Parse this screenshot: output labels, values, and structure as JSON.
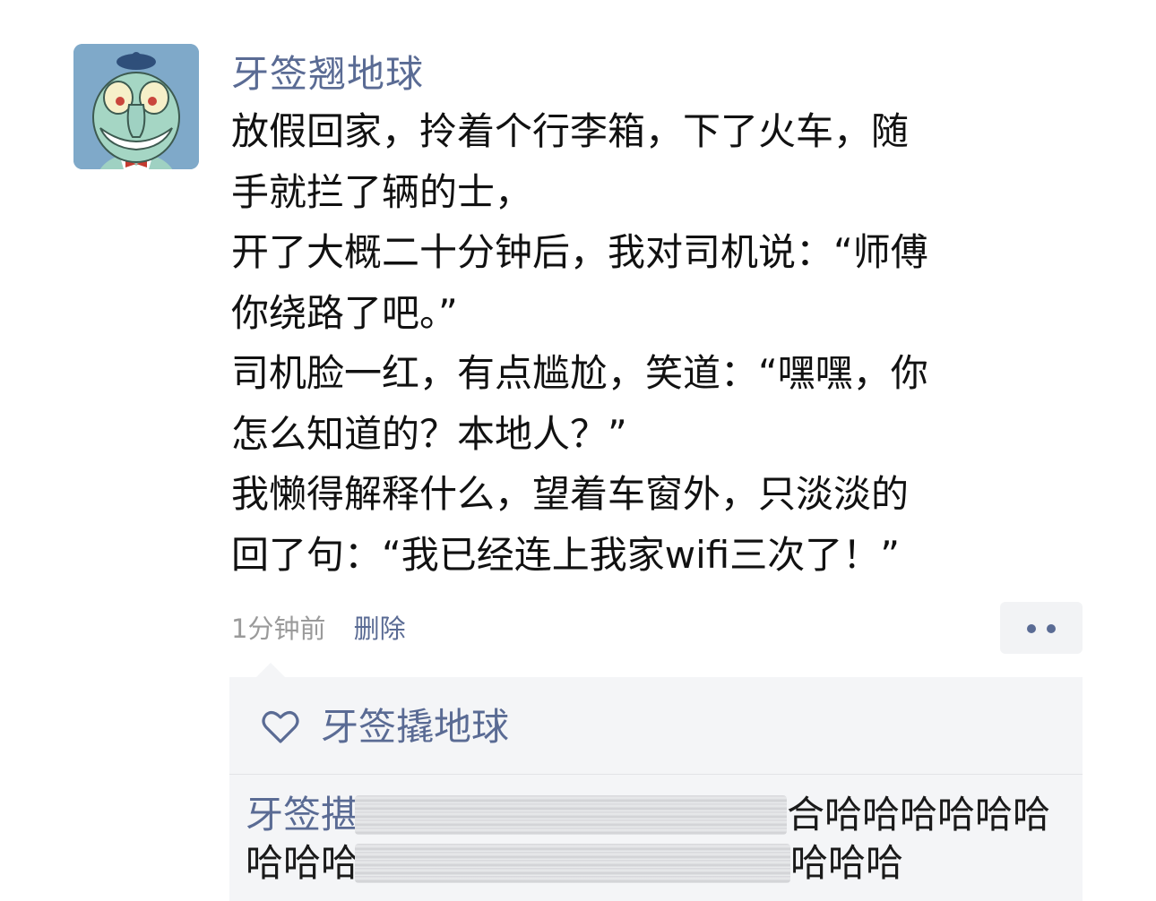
{
  "post": {
    "username": "牙签翘地球",
    "lines": [
      "放假回家，拎着个行李箱，下了火车，随",
      "手就拦了辆的士，",
      "开了大概二十分钟后，我对司机说：“师傅",
      "你绕路了吧。”",
      "司机脸一红，有点尴尬，笑道：“嘿嘿，你",
      "怎么知道的？本地人？”",
      "我懒得解释什么，望着车窗外，只淡淡的",
      "回了句：“我已经连上我家wifi三次了！”"
    ],
    "time": "1分钟前",
    "delete_label": "删除"
  },
  "more_button": {
    "icon": "more-dots-icon"
  },
  "likes": {
    "icon": "heart-outline-icon",
    "names": "牙签撬地球"
  },
  "comments": [
    {
      "author_visible": "牙签揕",
      "text_visible": "合哈哈哈哈哈哈"
    },
    {
      "text_prefix": "哈哈哈",
      "text_visible": "哈哈哈"
    }
  ],
  "colors": {
    "link": "#5a6b94",
    "panel": "#f4f5f7"
  }
}
